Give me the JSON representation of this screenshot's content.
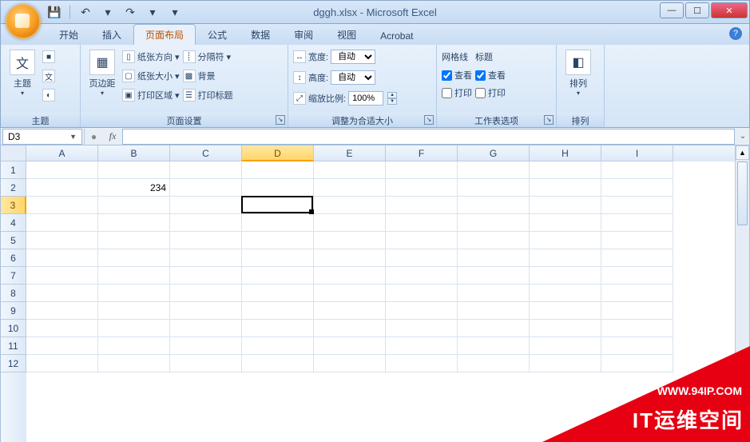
{
  "title": "dggh.xlsx - Microsoft Excel",
  "qat": {
    "save": "💾",
    "undo": "↶",
    "redo": "↷",
    "dd": "▾"
  },
  "tabs": [
    "开始",
    "插入",
    "页面布局",
    "公式",
    "数据",
    "审阅",
    "视图",
    "Acrobat"
  ],
  "active_tab_index": 2,
  "ribbon": {
    "themes": {
      "label": "主题",
      "btn": "主题",
      "i1": "颜",
      "i2": "文",
      "i3": "效"
    },
    "page_setup": {
      "label": "页面设置",
      "margins": "页边距",
      "orient": "纸张方向",
      "size": "纸张大小",
      "area": "打印区域",
      "breaks": "分隔符",
      "bg": "背景",
      "titles": "打印标题"
    },
    "scale": {
      "label": "调整为合适大小",
      "width": "宽度:",
      "height": "高度:",
      "ratio": "缩放比例:",
      "auto": "自动",
      "pct": "100%"
    },
    "sheet_opts": {
      "label": "工作表选项",
      "grid": "网格线",
      "head": "标题",
      "view": "查看",
      "print": "打印"
    },
    "arrange": {
      "label": "排列",
      "btn": "排列"
    }
  },
  "name_box": "D3",
  "formula": "",
  "columns": [
    "A",
    "B",
    "C",
    "D",
    "E",
    "F",
    "G",
    "H",
    "I"
  ],
  "rows": [
    "1",
    "2",
    "3",
    "4",
    "5",
    "6",
    "7",
    "8",
    "9",
    "10",
    "11",
    "12"
  ],
  "selected_col_index": 3,
  "selected_row_index": 2,
  "cells": {
    "B2": "234"
  },
  "watermark": {
    "url": "WWW.94IP.COM",
    "text": "IT运维空间"
  }
}
